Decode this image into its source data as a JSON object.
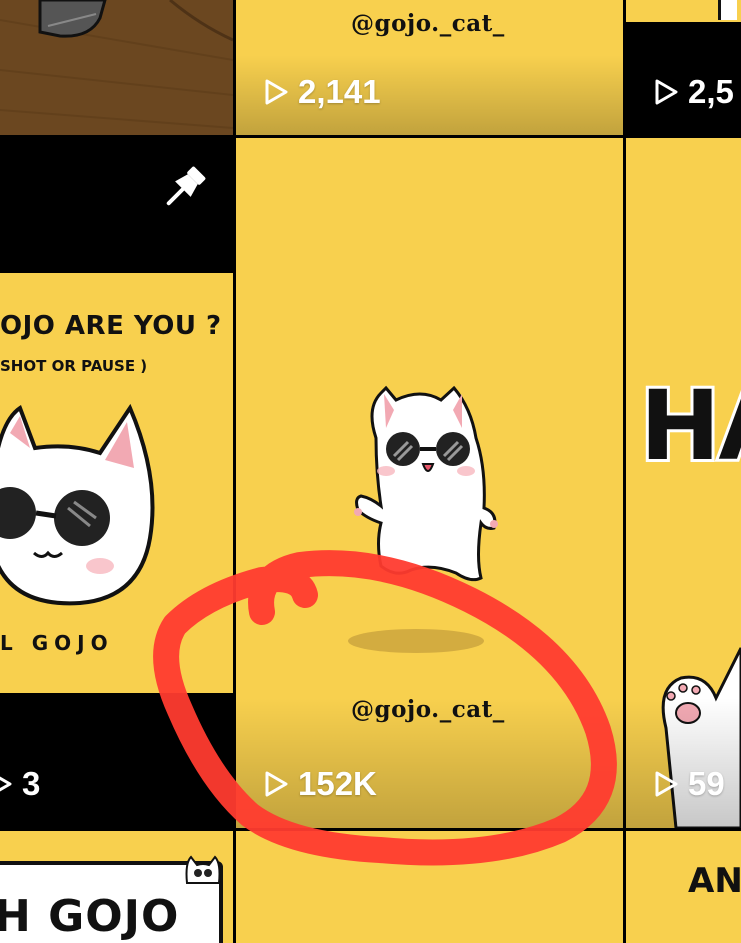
{
  "grid": {
    "tiles": [
      {
        "views": "2,141",
        "handle": "@gojo._cat_"
      },
      {
        "views": "2,5"
      },
      {
        "views": "152K",
        "handle": "@gojo._cat_"
      },
      {
        "views": "3",
        "caption_line1": "OJO ARE YOU ?",
        "caption_line2": "SHOT OR PAUSE )",
        "caption_bottom": "L GOJO",
        "pinned": true
      },
      {
        "views": "59",
        "big_text": "HA"
      },
      {
        "title_text": "H GOJO"
      },
      {
        "title_text": "AN"
      }
    ]
  },
  "annotation": {
    "color": "#ff3b2f",
    "shape": "hand-drawn circle around 152K tile"
  },
  "colors": {
    "tile_yellow": "#f8d04e",
    "desk_brown": "#6e4a22",
    "separator": "#000000"
  },
  "icons": {
    "views": "play-outline-icon",
    "pinned": "pin-icon"
  }
}
